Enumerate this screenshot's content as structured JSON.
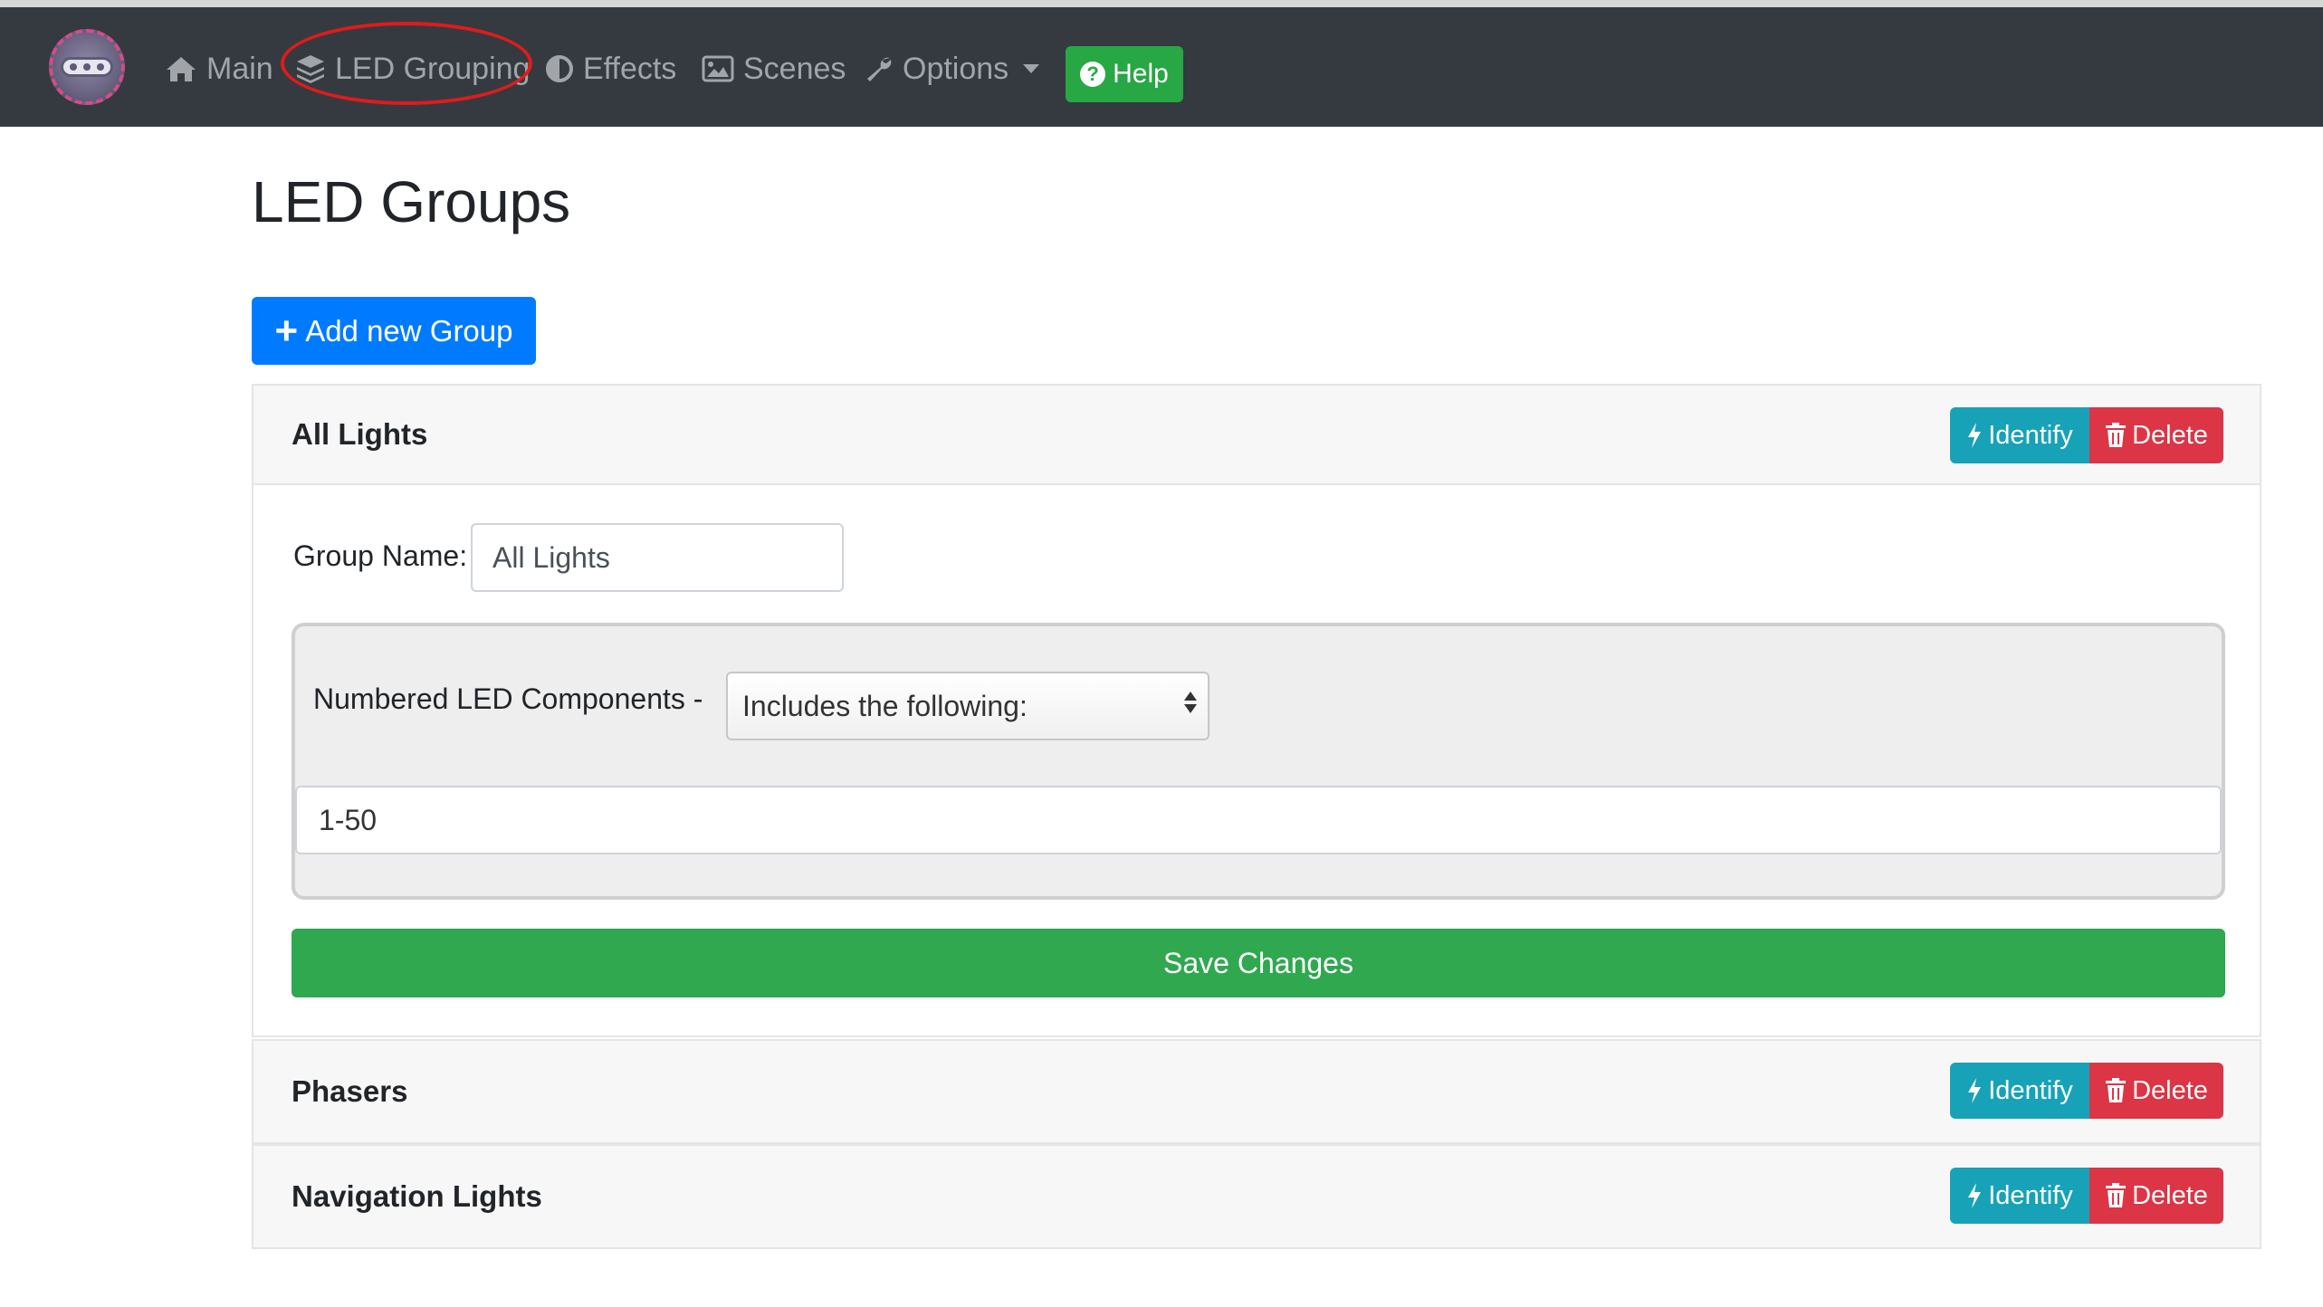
{
  "nav": {
    "items": [
      {
        "label": "Main",
        "icon": "home-icon"
      },
      {
        "label": "LED Grouping",
        "icon": "layers-icon"
      },
      {
        "label": "Effects",
        "icon": "contrast-icon"
      },
      {
        "label": "Scenes",
        "icon": "image-icon"
      },
      {
        "label": "Options",
        "icon": "wrench-icon"
      }
    ],
    "help_label": "Help"
  },
  "page": {
    "title": "LED Groups",
    "add_button": "Add new Group"
  },
  "groups": [
    {
      "name": "All Lights",
      "expanded": true,
      "identify_label": "Identify",
      "delete_label": "Delete",
      "group_name_label": "Group Name:",
      "group_name_value": "All Lights",
      "components_label": "Numbered LED Components -",
      "components_mode": "Includes the following:",
      "components_range": "1-50",
      "save_label": "Save Changes"
    },
    {
      "name": "Phasers",
      "expanded": false,
      "identify_label": "Identify",
      "delete_label": "Delete"
    },
    {
      "name": "Navigation Lights",
      "expanded": false,
      "identify_label": "Identify",
      "delete_label": "Delete"
    }
  ],
  "colors": {
    "navbar": "#343a40",
    "primary": "#007bff",
    "success": "#28a745",
    "info": "#17a2b8",
    "danger": "#dc3545",
    "annotation": "#e01b1b"
  }
}
